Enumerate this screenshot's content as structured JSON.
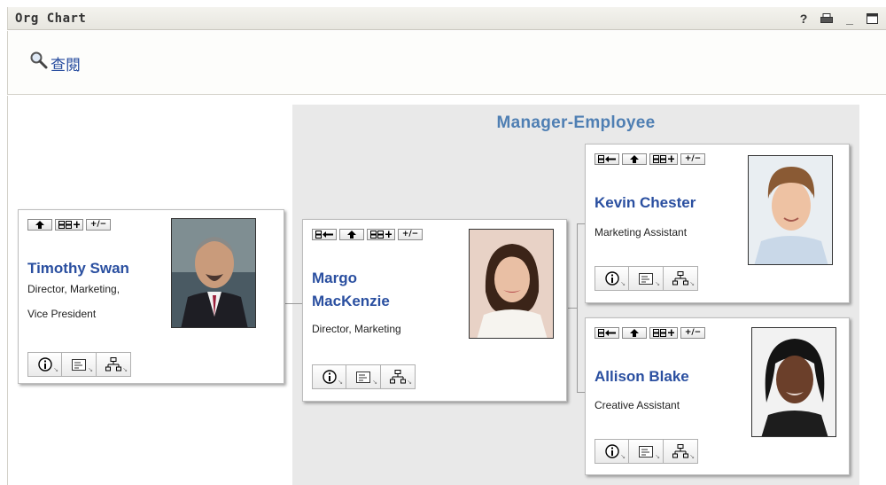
{
  "window": {
    "title": "Org Chart",
    "icons": [
      "help-icon",
      "print-icon",
      "minimize-icon",
      "maximize-icon"
    ],
    "help_label": "?",
    "min_label": "_"
  },
  "search": {
    "label": "查閱",
    "icon": "magnifier-icon"
  },
  "panel": {
    "title": "Manager-Employee",
    "bg": "#e9e9e9",
    "title_color": "#4f7fb3"
  },
  "colors": {
    "link": "#2a4fa0"
  },
  "mini_buttons": {
    "collapse": "+/−"
  },
  "people": {
    "timothy": {
      "name": "Timothy Swan",
      "role_line1": "Director, Marketing,",
      "role_line2": "Vice President"
    },
    "margo": {
      "name_line1": "Margo",
      "name_line2": "MacKenzie",
      "role": "Director, Marketing"
    },
    "kevin": {
      "name": "Kevin Chester",
      "role": "Marketing Assistant"
    },
    "allison": {
      "name": "Allison Blake",
      "role": "Creative Assistant"
    }
  },
  "card_actions": [
    "info-icon",
    "vcard-icon",
    "org-structure-icon"
  ]
}
